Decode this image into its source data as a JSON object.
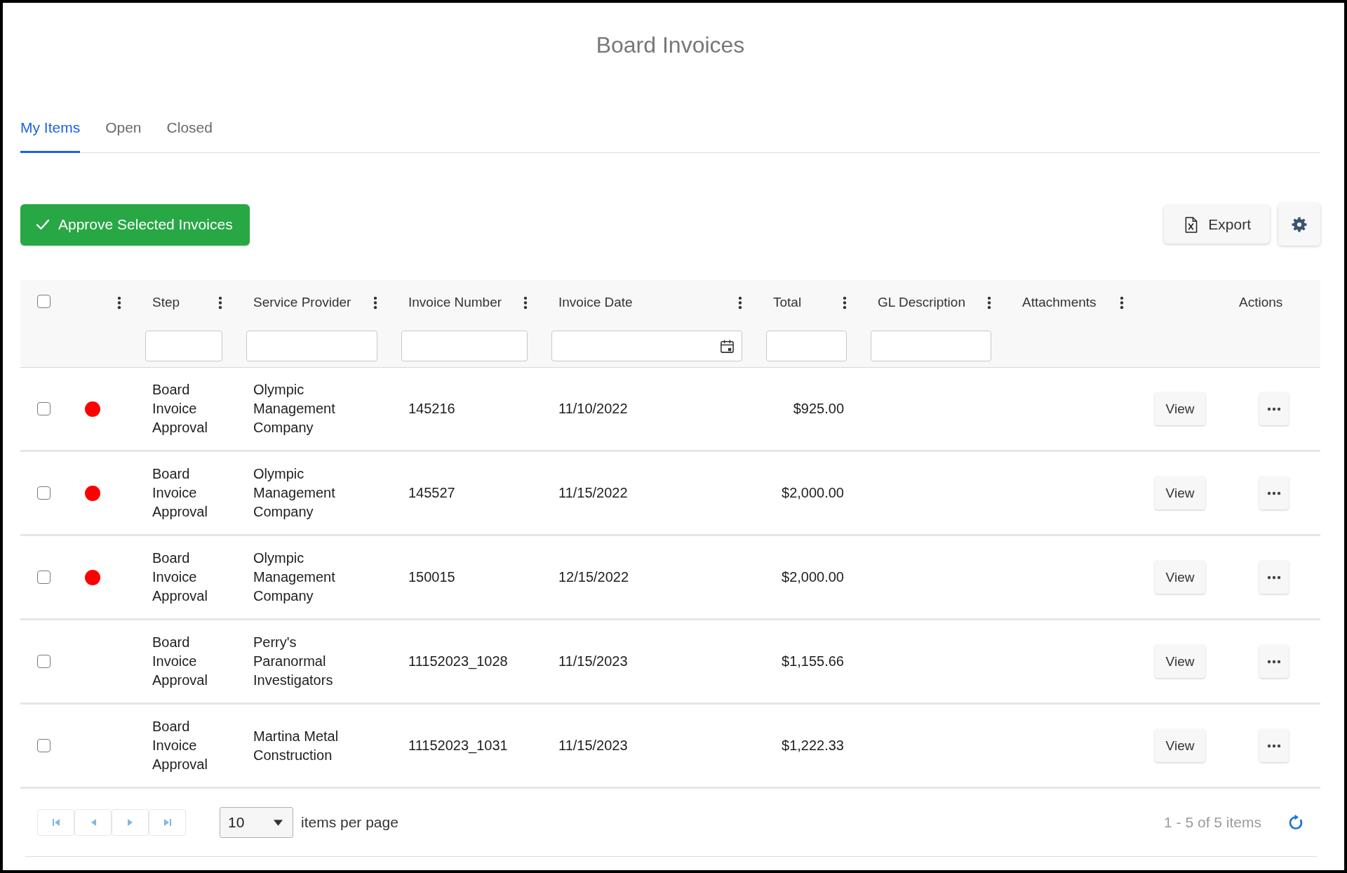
{
  "page": {
    "title": "Board Invoices"
  },
  "tabs": [
    {
      "label": "My Items",
      "selected": true
    },
    {
      "label": "Open",
      "selected": false
    },
    {
      "label": "Closed",
      "selected": false
    }
  ],
  "toolbar": {
    "approve_button": "Approve Selected Invoices",
    "export_button": "Export"
  },
  "table": {
    "select_all": {
      "checked": false
    },
    "columns": [
      {
        "kind": "status",
        "menu": true
      },
      {
        "kind": "text",
        "label": "Step",
        "menu": true,
        "filter": true
      },
      {
        "kind": "text",
        "label": "Service Provider",
        "menu": true,
        "filter": true
      },
      {
        "kind": "text",
        "label": "Invoice Number",
        "menu": true,
        "filter": true
      },
      {
        "kind": "date",
        "label": "Invoice Date",
        "menu": true,
        "filter": true
      },
      {
        "kind": "text",
        "label": "Total",
        "menu": true,
        "filter": true
      },
      {
        "kind": "text",
        "label": "GL Description",
        "menu": true,
        "filter": true
      },
      {
        "kind": "text",
        "label": "Attachments",
        "menu": true,
        "filter": false
      },
      {
        "kind": "blank"
      },
      {
        "kind": "text",
        "label": "Actions",
        "menu": false,
        "filter": false
      }
    ],
    "rows": [
      {
        "selected": false,
        "status_dot": true,
        "step": "Board Invoice Approval",
        "service_provider": "Olympic Management Company",
        "invoice_number": "145216",
        "invoice_date": "11/10/2022",
        "total": "$925.00",
        "view_button": "View"
      },
      {
        "selected": false,
        "status_dot": true,
        "step": "Board Invoice Approval",
        "service_provider": "Olympic Management Company",
        "invoice_number": "145527",
        "invoice_date": "11/15/2022",
        "total": "$2,000.00",
        "view_button": "View"
      },
      {
        "selected": false,
        "status_dot": true,
        "step": "Board Invoice Approval",
        "service_provider": "Olympic Management Company",
        "invoice_number": "150015",
        "invoice_date": "12/15/2022",
        "total": "$2,000.00",
        "view_button": "View"
      },
      {
        "selected": false,
        "status_dot": false,
        "step": "Board Invoice Approval",
        "service_provider": "Perry's Paranormal Investigators",
        "invoice_number": "11152023_1028",
        "invoice_date": "11/15/2023",
        "total": "$1,155.66",
        "view_button": "View"
      },
      {
        "selected": false,
        "status_dot": false,
        "step": "Board Invoice Approval",
        "service_provider": "Martina Metal Construction",
        "invoice_number": "11152023_1031",
        "invoice_date": "11/15/2023",
        "total": "$1,222.33",
        "view_button": "View"
      }
    ]
  },
  "pager": {
    "buttons": [
      {
        "kind": "first",
        "disabled": true
      },
      {
        "kind": "previous",
        "disabled": true
      },
      {
        "kind": "next",
        "disabled": true
      },
      {
        "kind": "last",
        "disabled": true
      }
    ],
    "page_size": "10",
    "page_size_label": "items per page",
    "summary": "1 - 5 of 5 items"
  }
}
